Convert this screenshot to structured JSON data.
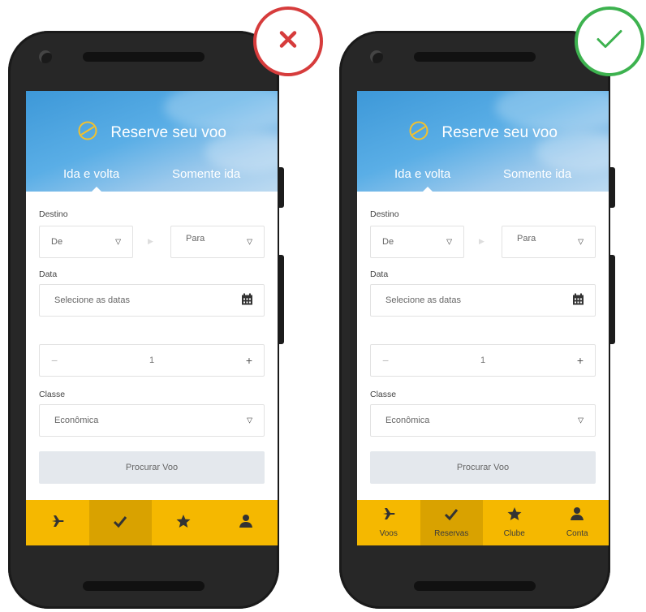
{
  "variants": [
    {
      "verdict": "incorrect",
      "verdict_icon": "x-icon",
      "header": {
        "title": "Reserve seu voo",
        "icon": "plane-circle-icon"
      },
      "tabs": [
        {
          "label": "Ida e volta",
          "active": true
        },
        {
          "label": "Somente ida",
          "active": false
        }
      ],
      "form": {
        "destino_label": "Destino",
        "from": "De",
        "to": "Para",
        "data_label": "Data",
        "date_placeholder": "Selecione as datas",
        "passengers": "1",
        "minus": "−",
        "plus": "+",
        "classe_label": "Classe",
        "classe_value": "Econômica",
        "search_button": "Procurar Voo"
      },
      "nav": {
        "show_labels": false,
        "selected": 1,
        "items": [
          {
            "icon": "plane-icon",
            "label": ""
          },
          {
            "icon": "check-icon",
            "label": ""
          },
          {
            "icon": "star-icon",
            "label": ""
          },
          {
            "icon": "user-icon",
            "label": ""
          }
        ]
      }
    },
    {
      "verdict": "correct",
      "verdict_icon": "check-icon",
      "header": {
        "title": "Reserve seu voo",
        "icon": "plane-circle-icon"
      },
      "tabs": [
        {
          "label": "Ida e volta",
          "active": true
        },
        {
          "label": "Somente ida",
          "active": false
        }
      ],
      "form": {
        "destino_label": "Destino",
        "from": "De",
        "to": "Para",
        "data_label": "Data",
        "date_placeholder": "Selecione as datas",
        "passengers": "1",
        "minus": "−",
        "plus": "+",
        "classe_label": "Classe",
        "classe_value": "Econômica",
        "search_button": "Procurar Voo"
      },
      "nav": {
        "show_labels": true,
        "selected": 1,
        "items": [
          {
            "icon": "plane-icon",
            "label": "Voos"
          },
          {
            "icon": "check-icon",
            "label": "Reservas"
          },
          {
            "icon": "star-icon",
            "label": "Clube"
          },
          {
            "icon": "user-icon",
            "label": "Conta"
          }
        ]
      }
    }
  ],
  "colors": {
    "accent_yellow": "#f5b800",
    "nav_selected": "#d9a200",
    "header_blue": "#4aa3e0",
    "bad": "#d63c3c",
    "good": "#3db24f"
  }
}
